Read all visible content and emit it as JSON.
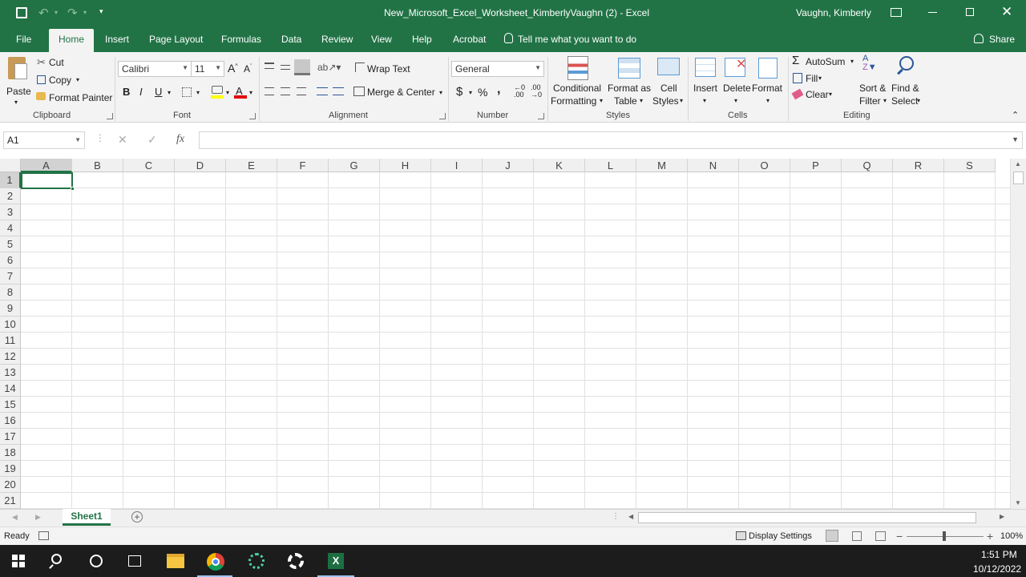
{
  "titlebar": {
    "filename": "New_Microsoft_Excel_Worksheet_KimberlyVaughn (2)  -  Excel",
    "user": "Vaughn, Kimberly"
  },
  "tabs": [
    "File",
    "Home",
    "Insert",
    "Page Layout",
    "Formulas",
    "Data",
    "Review",
    "View",
    "Help",
    "Acrobat"
  ],
  "tell_me": "Tell me what you want to do",
  "share": "Share",
  "ribbon": {
    "clipboard": {
      "paste": "Paste",
      "cut": "Cut",
      "copy": "Copy",
      "format_painter": "Format Painter",
      "label": "Clipboard"
    },
    "font": {
      "name": "Calibri",
      "size": "11",
      "bold": "B",
      "italic": "I",
      "underline": "U",
      "label": "Font"
    },
    "alignment": {
      "wrap": "Wrap Text",
      "merge": "Merge & Center",
      "label": "Alignment"
    },
    "number": {
      "format": "General",
      "currency": "$",
      "percent": "%",
      "comma": ",",
      "label": "Number"
    },
    "styles": {
      "cond1": "Conditional",
      "cond2": "Formatting",
      "fat1": "Format as",
      "fat2": "Table",
      "cs1": "Cell",
      "cs2": "Styles",
      "label": "Styles"
    },
    "cells": {
      "insert": "Insert",
      "delete": "Delete",
      "format": "Format",
      "label": "Cells"
    },
    "editing": {
      "autosum": "AutoSum",
      "fill": "Fill",
      "clear": "Clear",
      "sort1": "Sort &",
      "sort2": "Filter",
      "find1": "Find &",
      "find2": "Select",
      "label": "Editing"
    }
  },
  "formula_bar": {
    "name_box": "A1",
    "fx": "fx",
    "value": ""
  },
  "columns": [
    "A",
    "B",
    "C",
    "D",
    "E",
    "F",
    "G",
    "H",
    "I",
    "J",
    "K",
    "L",
    "M",
    "N",
    "O",
    "P",
    "Q",
    "R",
    "S"
  ],
  "rows": [
    "1",
    "2",
    "3",
    "4",
    "5",
    "6",
    "7",
    "8",
    "9",
    "10",
    "11",
    "12",
    "13",
    "14",
    "15",
    "16",
    "17",
    "18",
    "19",
    "20",
    "21"
  ],
  "sheets": [
    "Sheet1"
  ],
  "status": {
    "ready": "Ready",
    "display_settings": "Display Settings",
    "zoom": "100%"
  },
  "taskbar": {
    "time": "1:51 PM",
    "date": "10/12/2022"
  },
  "colors": {
    "excel_green": "#217346",
    "taskbar": "#1c1c1c"
  }
}
